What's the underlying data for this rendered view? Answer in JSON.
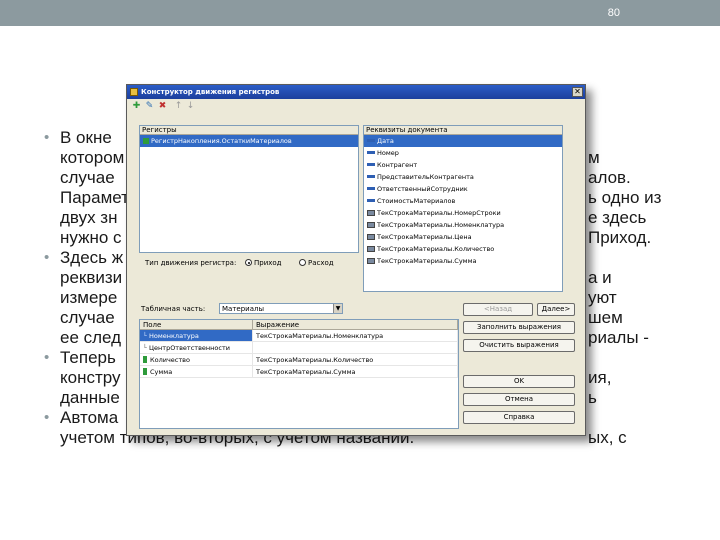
{
  "slide": {
    "page_number": "80",
    "bullets": [
      {
        "lines": [
          "В окне",
          "котором",
          "случае",
          "Парамет",
          "двух зн",
          "нужно с"
        ]
      },
      {
        "lines": [
          "Здесь ж",
          "реквизи",
          "измере",
          "случае",
          "ее след"
        ]
      },
      {
        "lines": [
          "Теперь",
          "констру",
          "данные"
        ]
      },
      {
        "lines": [
          "Автома",
          "учетом типов, во-вторых, с учетом названий."
        ]
      }
    ],
    "right_fragments": {
      "b1": [
        "м",
        "алов.",
        "ь одно из",
        "е здесь",
        "Приход."
      ],
      "b2": [
        "а и",
        "уют",
        "шем",
        "риалы -"
      ],
      "b3": [
        "ия,",
        "ь"
      ],
      "b4": [
        "ых, с"
      ]
    }
  },
  "dialog": {
    "title": "Конструктор движения регистров",
    "close_glyph": "✕",
    "registers": {
      "header": "Регистры",
      "items": [
        "РегистрНакопления.ОстаткиМатериалов"
      ]
    },
    "doc_attrs": {
      "header": "Реквизиты документа",
      "items": [
        "Дата",
        "Номер",
        "Контрагент",
        "ПредставительКонтрагента",
        "ОтветственныйСотрудник",
        "СтоимостьМатериалов",
        "ТекСтрокаМатериалы.НомерСтроки",
        "ТекСтрокаМатериалы.Номенклатура",
        "ТекСтрокаМатериалы.Цена",
        "ТекСтрокаМатериалы.Количество",
        "ТекСтрокаМатериалы.Сумма"
      ]
    },
    "movement_type_label": "Тип движения регистра:",
    "radio_income": "Приход",
    "radio_expense": "Расход",
    "tabular_label": "Табличная часть:",
    "tabular_value": "Материалы",
    "buttons": {
      "back": "<Назад",
      "next": "Далее>",
      "fill": "Заполнить выражения",
      "clear": "Очистить выражения",
      "ok": "OK",
      "cancel": "Отмена",
      "help": "Справка"
    },
    "grid": {
      "col_field": "Поле",
      "col_expr": "Выражение",
      "rows": [
        {
          "field": "Номенклатура",
          "expr": "ТекСтрокаМатериалы.Номенклатура"
        },
        {
          "field": "ЦентрОтветственности",
          "expr": ""
        },
        {
          "field": "Количество",
          "expr": "ТекСтрокаМатериалы.Количество"
        },
        {
          "field": "Сумма",
          "expr": "ТекСтрокаМатериалы.Сумма"
        }
      ]
    }
  },
  "colors": {
    "header_bar": "#8c9a9f",
    "selection": "#316ac5",
    "title_bar": "#2b5cc7"
  }
}
